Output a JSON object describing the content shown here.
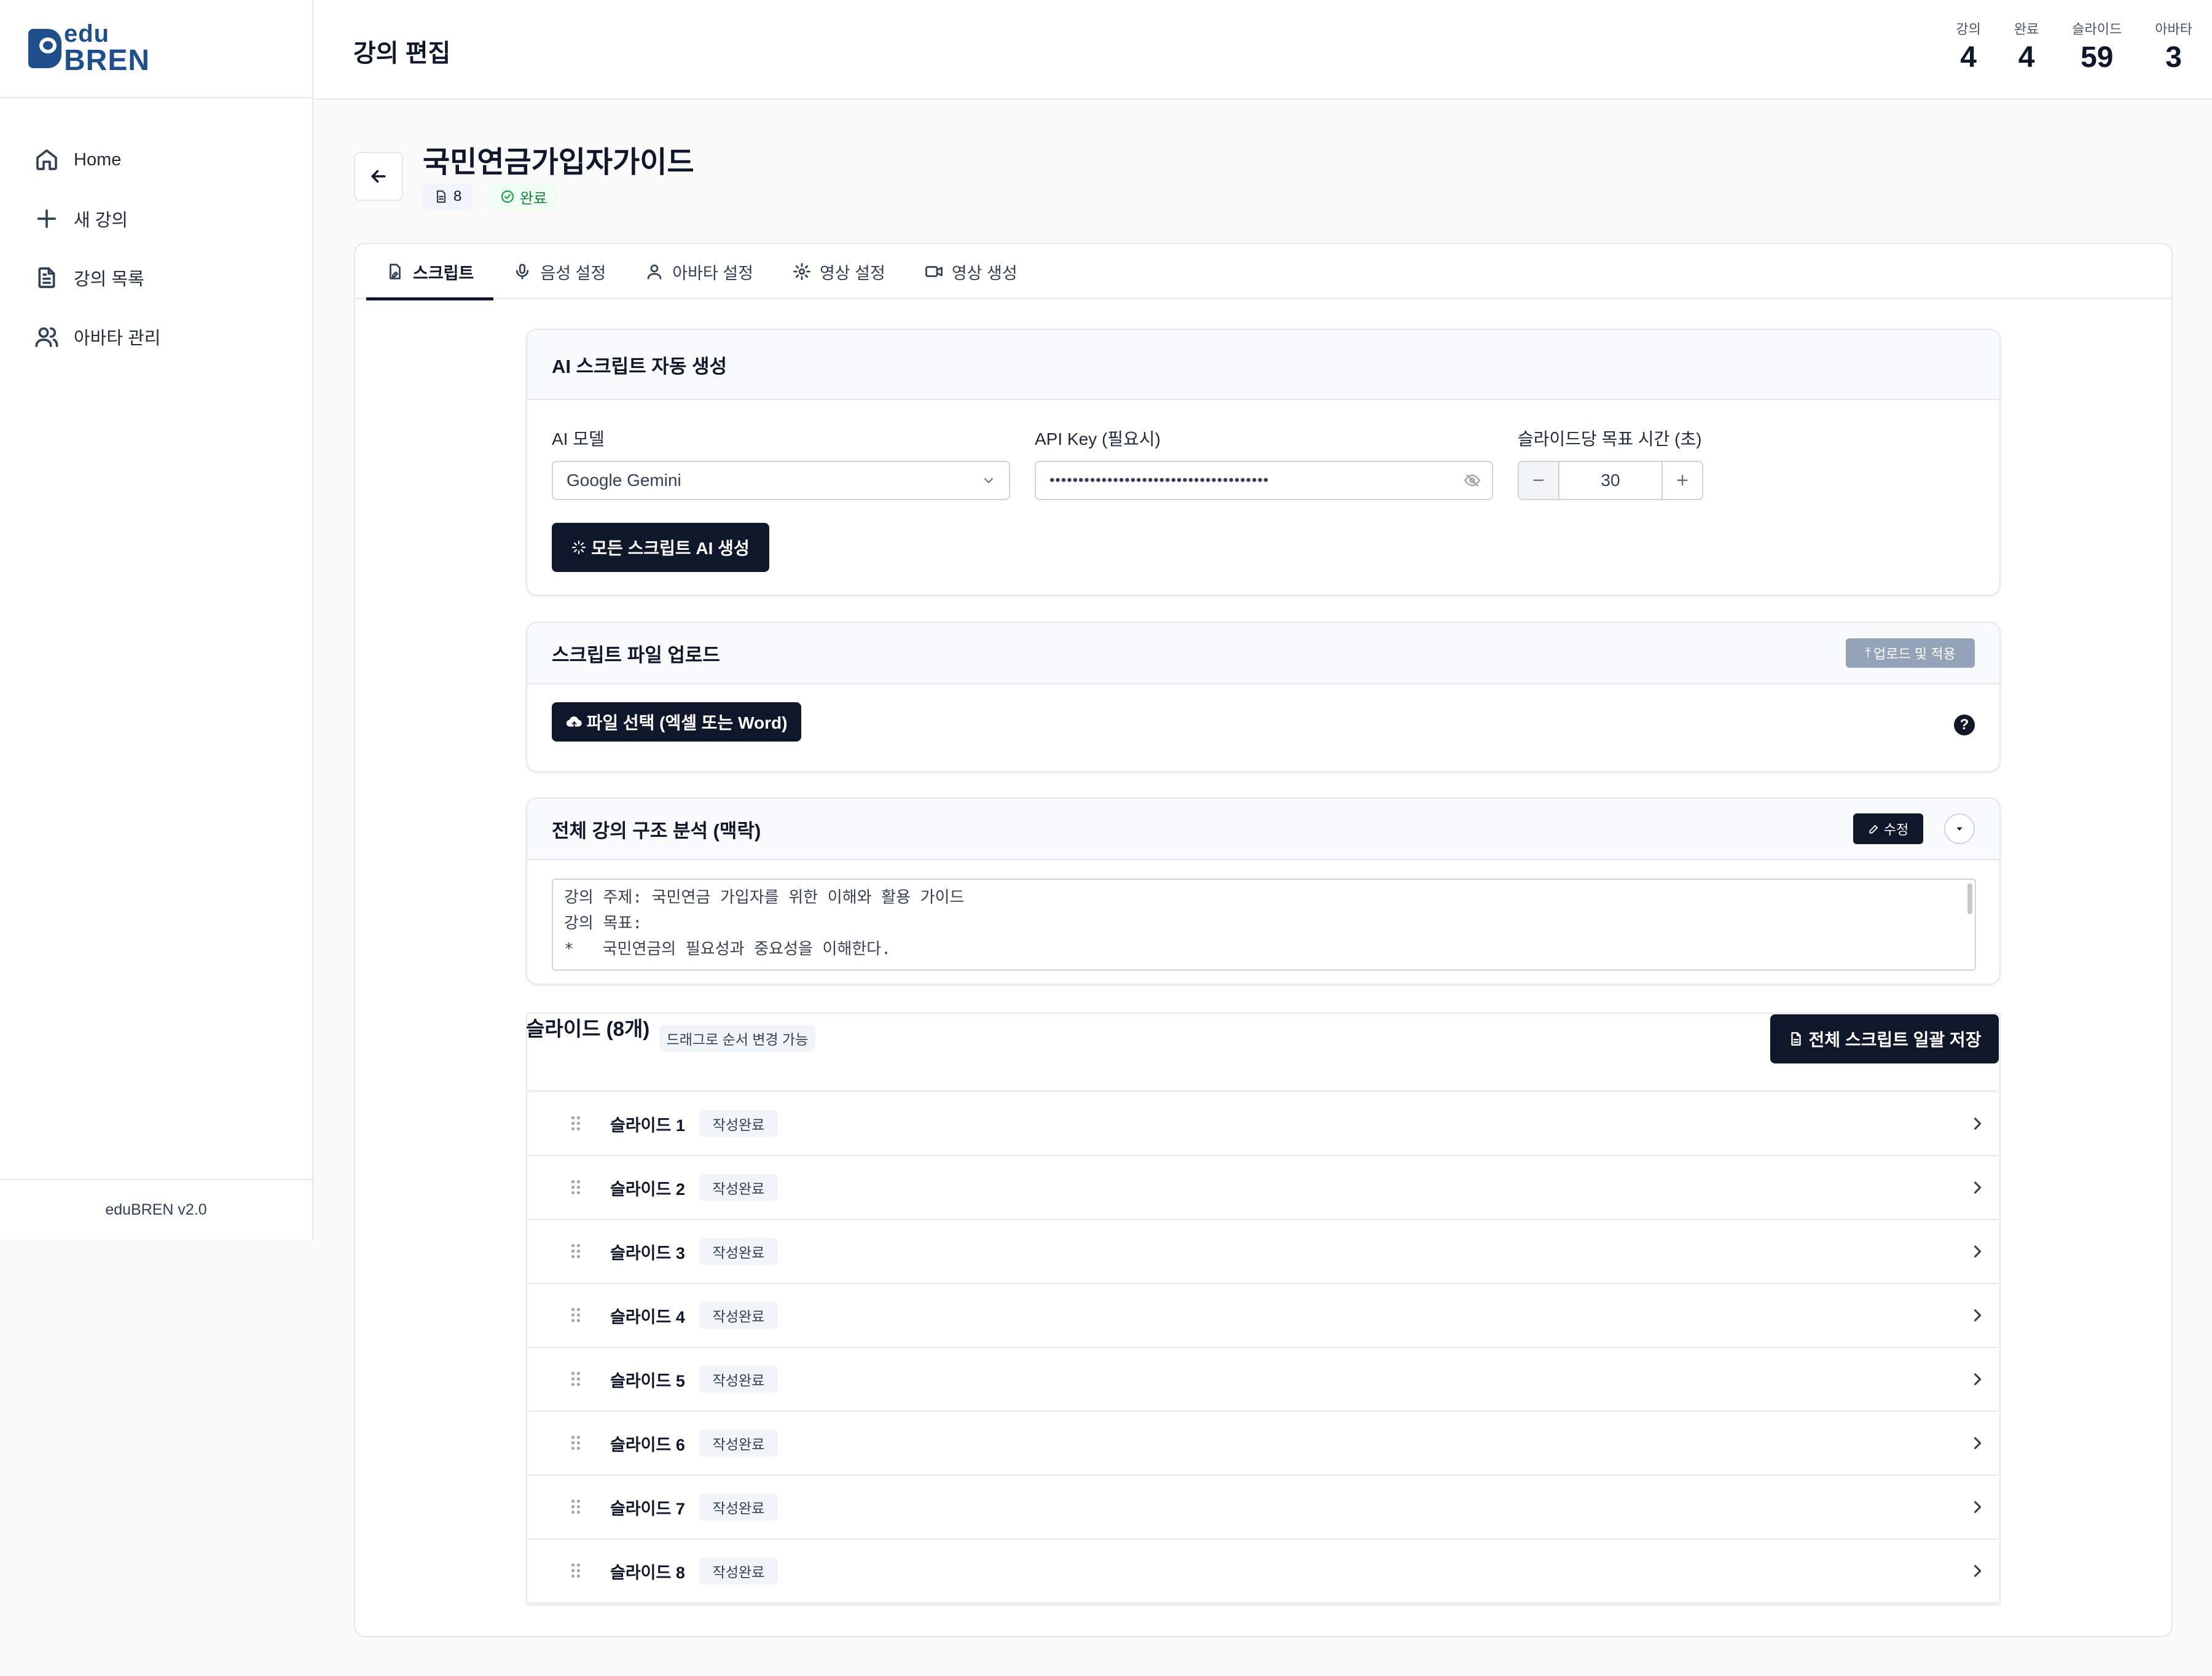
{
  "app": {
    "logo_top": "edu",
    "logo_bottom": "BREN",
    "version": "eduBREN v2.0"
  },
  "sidebar": {
    "items": [
      {
        "label": "Home",
        "icon": "home-icon"
      },
      {
        "label": "새 강의",
        "icon": "plus-icon"
      },
      {
        "label": "강의 목록",
        "icon": "document-icon"
      },
      {
        "label": "아바타 관리",
        "icon": "users-icon"
      }
    ]
  },
  "header": {
    "title": "강의 편집",
    "stats": [
      {
        "label": "강의",
        "value": "4"
      },
      {
        "label": "완료",
        "value": "4"
      },
      {
        "label": "슬라이드",
        "value": "59"
      },
      {
        "label": "아바타",
        "value": "3"
      }
    ]
  },
  "course": {
    "title": "국민연금가입자가이드",
    "slide_count": "8",
    "status": "완료"
  },
  "tabs": [
    {
      "label": "스크립트",
      "icon": "script-icon",
      "active": true
    },
    {
      "label": "음성 설정",
      "icon": "mic-icon"
    },
    {
      "label": "아바타 설정",
      "icon": "user-icon"
    },
    {
      "label": "영상 설정",
      "icon": "gear-icon"
    },
    {
      "label": "영상 생성",
      "icon": "video-icon"
    }
  ],
  "ai_panel": {
    "title": "AI 스크립트 자동 생성",
    "model_label": "AI 모델",
    "model_value": "Google Gemini",
    "api_label": "API Key (필요시)",
    "api_value": "••••••••••••••••••••••••••••••••••••••",
    "target_label": "슬라이드당 목표 시간 (초)",
    "target_value": "30",
    "generate_button": "모든 스크립트 AI 생성"
  },
  "upload_panel": {
    "title": "스크립트 파일 업로드",
    "apply_button": "업로드 및 적용",
    "select_button": "파일 선택 (엑셀 또는 Word)"
  },
  "analysis_panel": {
    "title": "전체 강의 구조 분석 (맥락)",
    "edit_button": "수정",
    "lines": [
      "강의 주제: 국민연금 가입자를 위한 이해와 활용 가이드",
      "강의 목표:",
      "*   국민연금의 필요성과 중요성을 이해한다."
    ]
  },
  "slides": {
    "title": "슬라이드 (8개)",
    "drag_hint": "드래그로 순서 변경 가능",
    "save_all_button": "전체 스크립트 일괄 저장",
    "items": [
      {
        "name": "슬라이드 1",
        "status": "작성완료"
      },
      {
        "name": "슬라이드 2",
        "status": "작성완료"
      },
      {
        "name": "슬라이드 3",
        "status": "작성완료"
      },
      {
        "name": "슬라이드 4",
        "status": "작성완료"
      },
      {
        "name": "슬라이드 5",
        "status": "작성완료"
      },
      {
        "name": "슬라이드 6",
        "status": "작성완료"
      },
      {
        "name": "슬라이드 7",
        "status": "작성완료"
      },
      {
        "name": "슬라이드 8",
        "status": "작성완료"
      }
    ]
  },
  "colors": {
    "brand": "#1f4e8c",
    "dark": "#0f172a",
    "success": "#16a34a"
  }
}
